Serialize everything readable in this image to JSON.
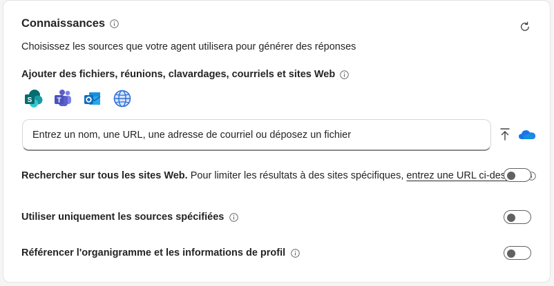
{
  "knowledge": {
    "title": "Connaissances",
    "subtitle": "Choisissez les sources que votre agent utilisera pour générer des réponses",
    "add_heading": "Ajouter des fichiers, réunions, clavardages, courriels et sites Web",
    "sources": [
      {
        "name": "SharePoint",
        "icon": "sharepoint-icon"
      },
      {
        "name": "Teams",
        "icon": "teams-icon"
      },
      {
        "name": "Outlook",
        "icon": "outlook-icon"
      },
      {
        "name": "Web",
        "icon": "globe-icon"
      }
    ],
    "input_placeholder": "Entrez un nom, une URL, une adresse de courriel ou déposez un fichier",
    "web_search": {
      "bold": "Rechercher sur tous les sites Web.",
      "normal": "Pour limiter les résultats à des sites spécifiques,",
      "link": "entrez une URL ci-dessus",
      "enabled": false
    },
    "only_sources": {
      "label": "Utiliser uniquement les sources spécifiées",
      "enabled": false
    },
    "org_chart": {
      "label": "Référencer l'organigramme et les informations de profil",
      "enabled": false
    }
  },
  "colors": {
    "accent_sharepoint": "#0f7b7f",
    "accent_teams": "#5b5fc7",
    "accent_outlook": "#0f6cbd",
    "accent_onedrive": "#1a73e8"
  }
}
